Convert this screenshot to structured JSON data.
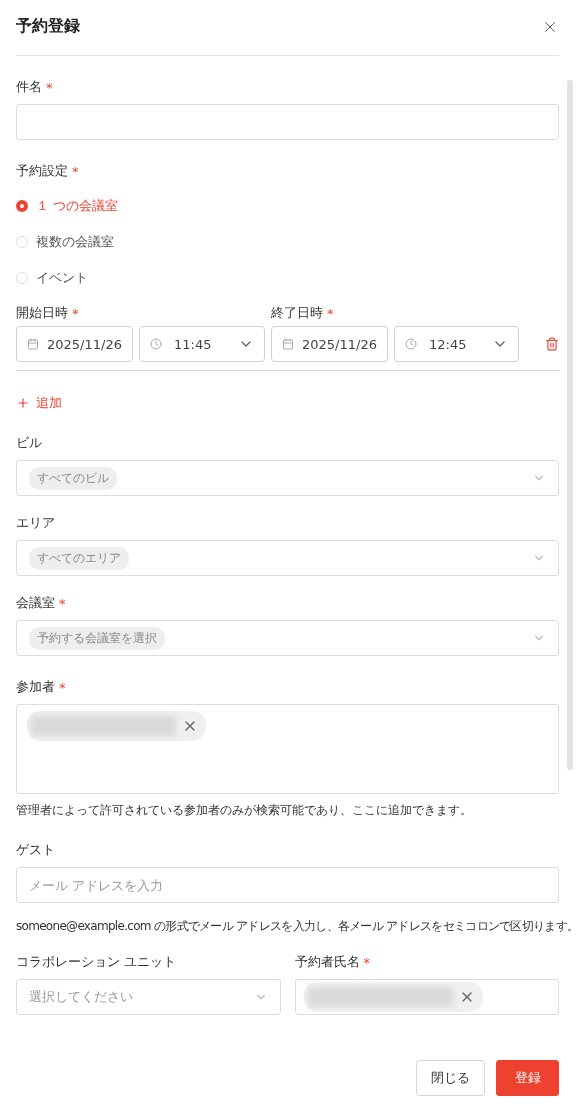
{
  "dialog": {
    "title": "予約登録"
  },
  "required_mark": "*",
  "subject": {
    "label": "件名",
    "required": true
  },
  "booking_type": {
    "label": "予約設定",
    "required": true,
    "options": [
      {
        "label": "１ つの会議室",
        "selected": true
      },
      {
        "label": "複数の会議室",
        "selected": false
      },
      {
        "label": "イベント",
        "selected": false
      }
    ]
  },
  "schedule": {
    "start_label": "開始日時",
    "end_label": "終了日時",
    "required": true,
    "rows": [
      {
        "start_date": "2025/11/26",
        "start_time": "11:45",
        "end_date": "2025/11/26",
        "end_time": "12:45"
      }
    ]
  },
  "add_button": "追加",
  "selects": [
    {
      "label": "ビル",
      "required": false,
      "tag": "すべてのビル"
    },
    {
      "label": "エリア",
      "required": false,
      "tag": "すべてのエリア"
    },
    {
      "label": "会議室",
      "required": true,
      "tag": "予約する会議室を選択"
    }
  ],
  "participants": {
    "label": "参加者",
    "required": true,
    "chips": [
      {
        "kind": "redacted"
      }
    ],
    "help": "管理者によって許可されている参加者のみが検索可能であり、ここに追加できます。"
  },
  "guest": {
    "label": "ゲスト",
    "required": false,
    "placeholder": "メール アドレスを入力",
    "help": "someone@example.com の形式でメール アドレスを入力し、各メール アドレスをセミコロンで区切ります。"
  },
  "collaboration_unit": {
    "label": "コラボレーション ユニット",
    "required": false,
    "placeholder": "選択してください"
  },
  "organizer": {
    "label": "予約者氏名",
    "required": true,
    "chips": [
      {
        "kind": "redacted"
      }
    ]
  },
  "buttons": [
    {
      "label": "閉じる",
      "kind": "secondary"
    },
    {
      "label": "登録",
      "kind": "primary"
    }
  ]
}
